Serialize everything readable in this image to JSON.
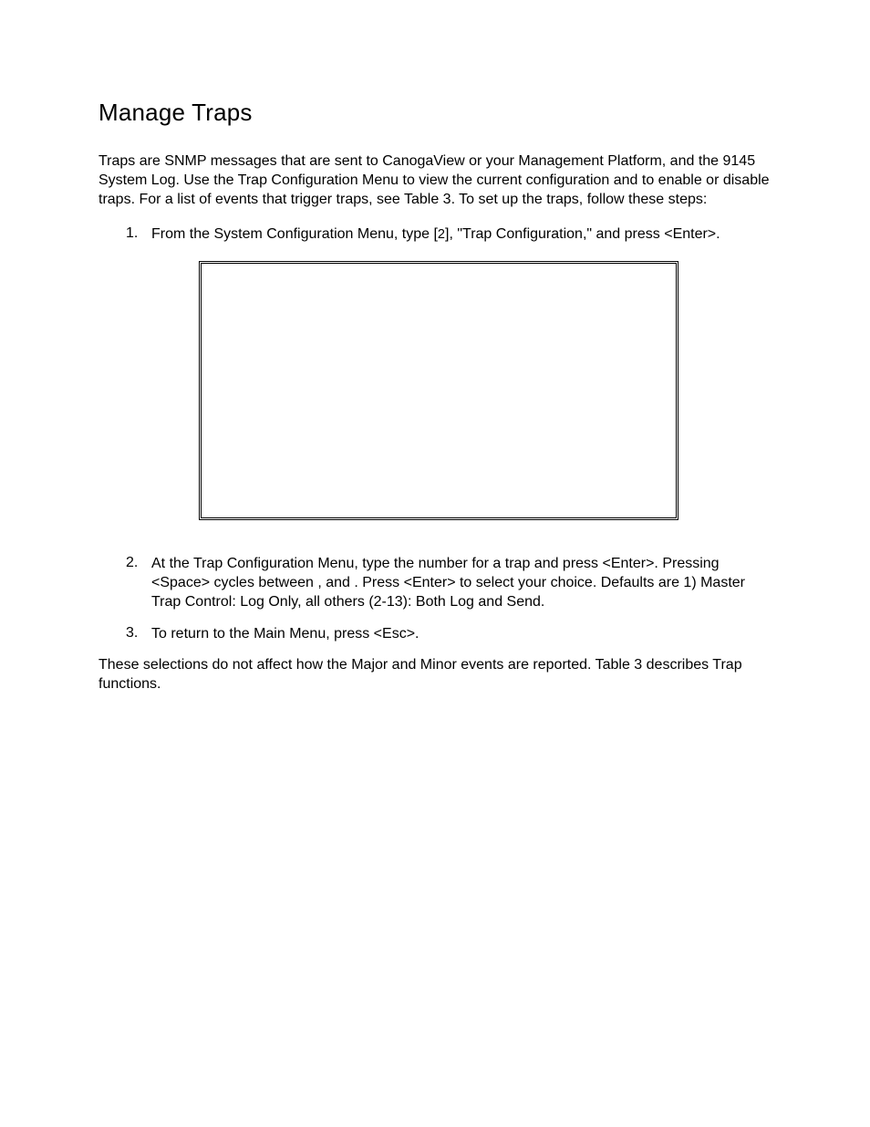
{
  "heading": "Manage Traps",
  "intro": "Traps are SNMP messages that are sent to CanogaView or your Management Platform, and the 9145 System Log.  Use the Trap Configuration Menu to view the current configuration and to enable or disable traps.  For a list of events that trigger traps, see Table 3.  To set up the traps, follow these steps:",
  "steps": [
    {
      "num": "1.",
      "text_pre": "From the System Configuration Menu, type [",
      "num_inline": "2",
      "text_post": "], \"Trap Configuration,\" and press <Enter>."
    },
    {
      "num": "2.",
      "text": "At the Trap Configuration Menu, type the number for a trap and press <Enter>.  Pressing <Space> cycles between                ,                                          and              .  Press <Enter> to select your choice.  Defaults are 1) Master Trap Control: Log Only, all others (2-13): Both Log and Send."
    },
    {
      "num": "3.",
      "text": "To return to the Main Menu, press <Esc>."
    }
  ],
  "closing": "These selections do not affect how the Major and Minor events are reported.  Table 3 describes Trap functions."
}
